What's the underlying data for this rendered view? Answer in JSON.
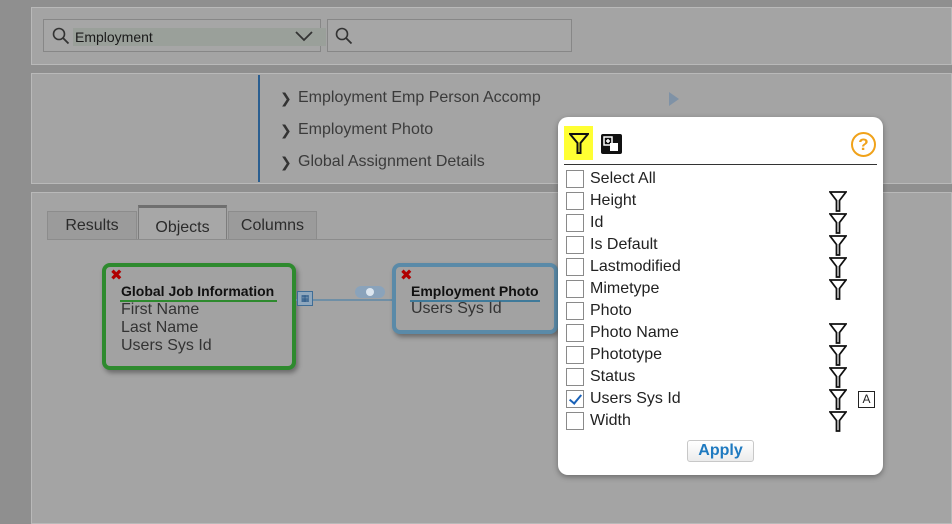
{
  "search": {
    "value": "Employment",
    "secondary_value": ""
  },
  "nav": {
    "items": [
      {
        "label": "Employment Emp Person Accomp"
      },
      {
        "label": "Employment Photo"
      },
      {
        "label": "Global Assignment Details"
      }
    ]
  },
  "tabs": [
    {
      "label": "Results",
      "active": false
    },
    {
      "label": "Objects",
      "active": true
    },
    {
      "label": "Columns",
      "active": false
    }
  ],
  "cards": {
    "global_job": {
      "title": "Global Job Information",
      "fields": [
        "First Name",
        "Last Name",
        "Users Sys Id"
      ]
    },
    "employment_photo": {
      "title": "Employment Photo",
      "fields": [
        "Users Sys Id"
      ]
    }
  },
  "popup": {
    "help_symbol": "?",
    "select_all_label": "Select All",
    "fields": [
      {
        "label": "Height",
        "checked": false,
        "filter_icon": true,
        "alias_icon": false
      },
      {
        "label": "Id",
        "checked": false,
        "filter_icon": true,
        "alias_icon": false
      },
      {
        "label": "Is Default",
        "checked": false,
        "filter_icon": true,
        "alias_icon": false
      },
      {
        "label": "Lastmodified",
        "checked": false,
        "filter_icon": true,
        "alias_icon": false
      },
      {
        "label": "Mimetype",
        "checked": false,
        "filter_icon": true,
        "alias_icon": false
      },
      {
        "label": "Photo",
        "checked": false,
        "filter_icon": false,
        "alias_icon": false
      },
      {
        "label": "Photo Name",
        "checked": false,
        "filter_icon": true,
        "alias_icon": false
      },
      {
        "label": "Phototype",
        "checked": false,
        "filter_icon": true,
        "alias_icon": false
      },
      {
        "label": "Status",
        "checked": false,
        "filter_icon": true,
        "alias_icon": false
      },
      {
        "label": "Users Sys Id",
        "checked": true,
        "filter_icon": true,
        "alias_icon": true
      },
      {
        "label": "Width",
        "checked": false,
        "filter_icon": true,
        "alias_icon": false
      }
    ],
    "alias_icon_text": "A",
    "apply_label": "Apply"
  },
  "colors": {
    "highlight": "#ffff33",
    "help": "#f0a21a",
    "apply_text": "#1f7ac0",
    "card_green": "#2e8a2e",
    "card_blue": "#5a8aa8",
    "delete_red": "#b00000"
  },
  "icons": {
    "search": "search-icon",
    "dropdown": "chevron-down-icon",
    "filter": "funnel-icon",
    "expand": "expand-icon",
    "help": "help-icon",
    "delete": "close-icon"
  }
}
